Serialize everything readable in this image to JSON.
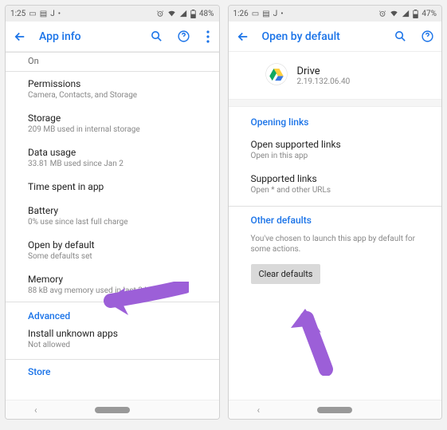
{
  "left": {
    "status": {
      "time": "1:25",
      "battery": "48%"
    },
    "title": "App info",
    "on_label": "On",
    "rows": {
      "permissions": {
        "label": "Permissions",
        "sub": "Camera, Contacts, and Storage"
      },
      "storage": {
        "label": "Storage",
        "sub": "209 MB used in internal storage"
      },
      "data": {
        "label": "Data usage",
        "sub": "33.81 MB used since Jan 2"
      },
      "time": {
        "label": "Time spent in app"
      },
      "battery": {
        "label": "Battery",
        "sub": "0% use since last full charge"
      },
      "open_default": {
        "label": "Open by default",
        "sub": "Some defaults set"
      },
      "memory": {
        "label": "Memory",
        "sub": "88 kB avg memory used in last 3 hours"
      },
      "advanced": "Advanced",
      "unknown": {
        "label": "Install unknown apps",
        "sub": "Not allowed"
      },
      "store": "Store"
    }
  },
  "right": {
    "status": {
      "time": "1:26",
      "battery": "47%"
    },
    "title": "Open by default",
    "app": {
      "name": "Drive",
      "version": "2.19.132.06.40"
    },
    "sections": {
      "opening_links": "Opening links",
      "open_supported": {
        "label": "Open supported links",
        "sub": "Open in this app"
      },
      "supported": {
        "label": "Supported links",
        "sub": "Open * and other URLs"
      },
      "other_defaults": "Other defaults",
      "note": "You've chosen to launch this app by default for some actions.",
      "clear": "Clear defaults"
    }
  }
}
